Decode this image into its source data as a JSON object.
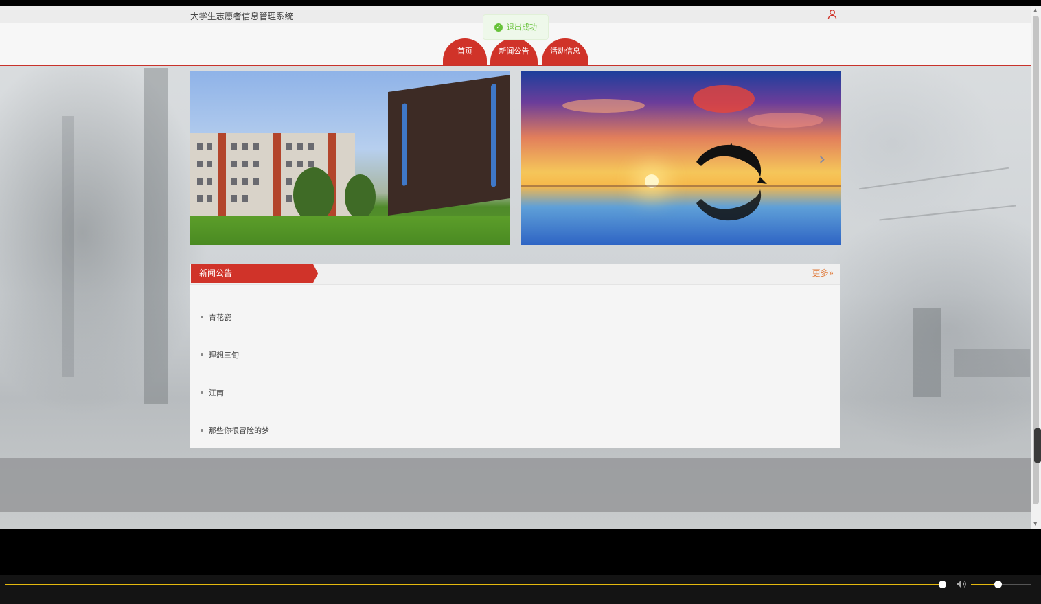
{
  "header": {
    "site_title": "大学生志愿者信息管理系统"
  },
  "toast": {
    "message": "退出成功"
  },
  "nav": {
    "tabs": [
      {
        "label": "首页"
      },
      {
        "label": "新闻公告"
      },
      {
        "label": "活动信息"
      }
    ]
  },
  "news": {
    "section_title": "新闻公告",
    "more_label": "更多",
    "items": [
      {
        "title": "青花瓷"
      },
      {
        "title": "理想三旬"
      },
      {
        "title": "江南"
      },
      {
        "title": "那些你很冒险的梦"
      }
    ]
  },
  "player": {
    "progress": 0.995,
    "volume": 0.45
  },
  "colors": {
    "brand_red": "#d03329",
    "more_orange": "#e07a3a",
    "toast_green": "#67c23a",
    "progress_yellow": "#e3b80f"
  },
  "icons": {
    "user": "user-icon",
    "toast": "check-circle-icon",
    "more": "double-chevron-right-icon",
    "carousel_next": "chevron-right-icon",
    "volume": "speaker-icon"
  }
}
